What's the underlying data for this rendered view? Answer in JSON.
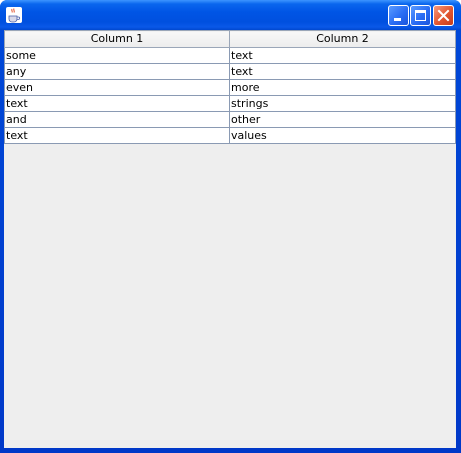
{
  "window": {
    "title": "",
    "icon": "java-cup-icon",
    "controls": {
      "minimize": "minimize-icon",
      "maximize": "maximize-icon",
      "close": "close-icon"
    }
  },
  "table": {
    "columns": [
      "Column 1",
      "Column 2"
    ],
    "rows": [
      [
        "some",
        "text"
      ],
      [
        "any",
        "text"
      ],
      [
        "even",
        "more"
      ],
      [
        "text",
        "strings"
      ],
      [
        "and",
        "other"
      ],
      [
        "text",
        "values"
      ]
    ]
  },
  "colors": {
    "titlebar": "#0055e5",
    "close_button": "#e2552f",
    "panel_background": "#eeeeee",
    "grid_line": "#8a9ab3"
  }
}
